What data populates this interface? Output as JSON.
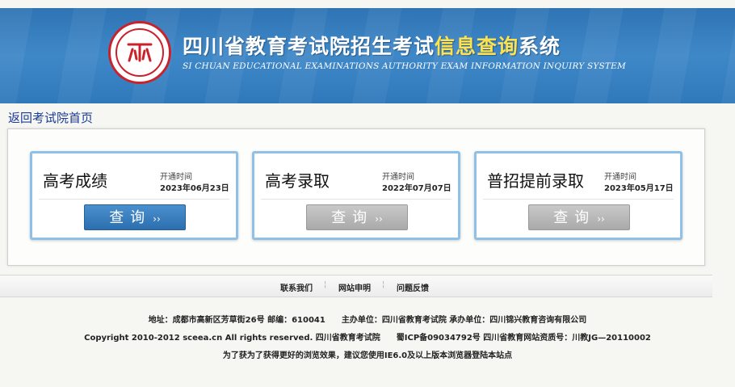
{
  "header": {
    "title_main": "四川省教育考试院招生考试",
    "title_highlight": "信息查询",
    "title_tail": "系统",
    "subtitle": "SI CHUAN EDUCATIONAL EXAMINATIONS AUTHORITY EXAM INFORMATION INQUIRY SYSTEM",
    "logo": "sceea-seal-logo"
  },
  "back_link": "返回考试院首页",
  "cards": [
    {
      "name": "高考成绩",
      "open_label": "开通时间",
      "open_date": "2023年06月23日",
      "button": "查询",
      "button_arrow": "››",
      "state": "active"
    },
    {
      "name": "高考录取",
      "open_label": "开通时间",
      "open_date": "2022年07月07日",
      "button": "查询",
      "button_arrow": "››",
      "state": "disabled"
    },
    {
      "name": "普招提前录取",
      "open_label": "开通时间",
      "open_date": "2023年05月17日",
      "button": "查询",
      "button_arrow": "››",
      "state": "disabled"
    }
  ],
  "nav": {
    "contact": "联系我们",
    "statement": "网站申明",
    "feedback": "问题反馈",
    "separator": "¦"
  },
  "footer": {
    "line1": "地址：成都市高新区芳草街26号 邮编：610041　　主办单位：四川省教育考试院 承办单位：四川锦兴教育咨询有限公司",
    "line2": "Copyright 2010-2012 sceea.cn All rights reserved. 四川省教育考试院　　蜀ICP备09034792号 四川省教育网站资质号：川教JG—20110002",
    "line3": "为了获为了获得更好的浏览效果，建议您使用IE6.0及以上版本浏览器登陆本站点"
  },
  "colors": {
    "header_blue": "#3f88c8",
    "highlight_yellow": "#fde24f",
    "link_blue": "#1a3a9a",
    "button_active": "#2d6fb0",
    "button_disabled": "#a9a9a9",
    "card_border": "#8fc1e8",
    "logo_red": "#c9222b"
  }
}
